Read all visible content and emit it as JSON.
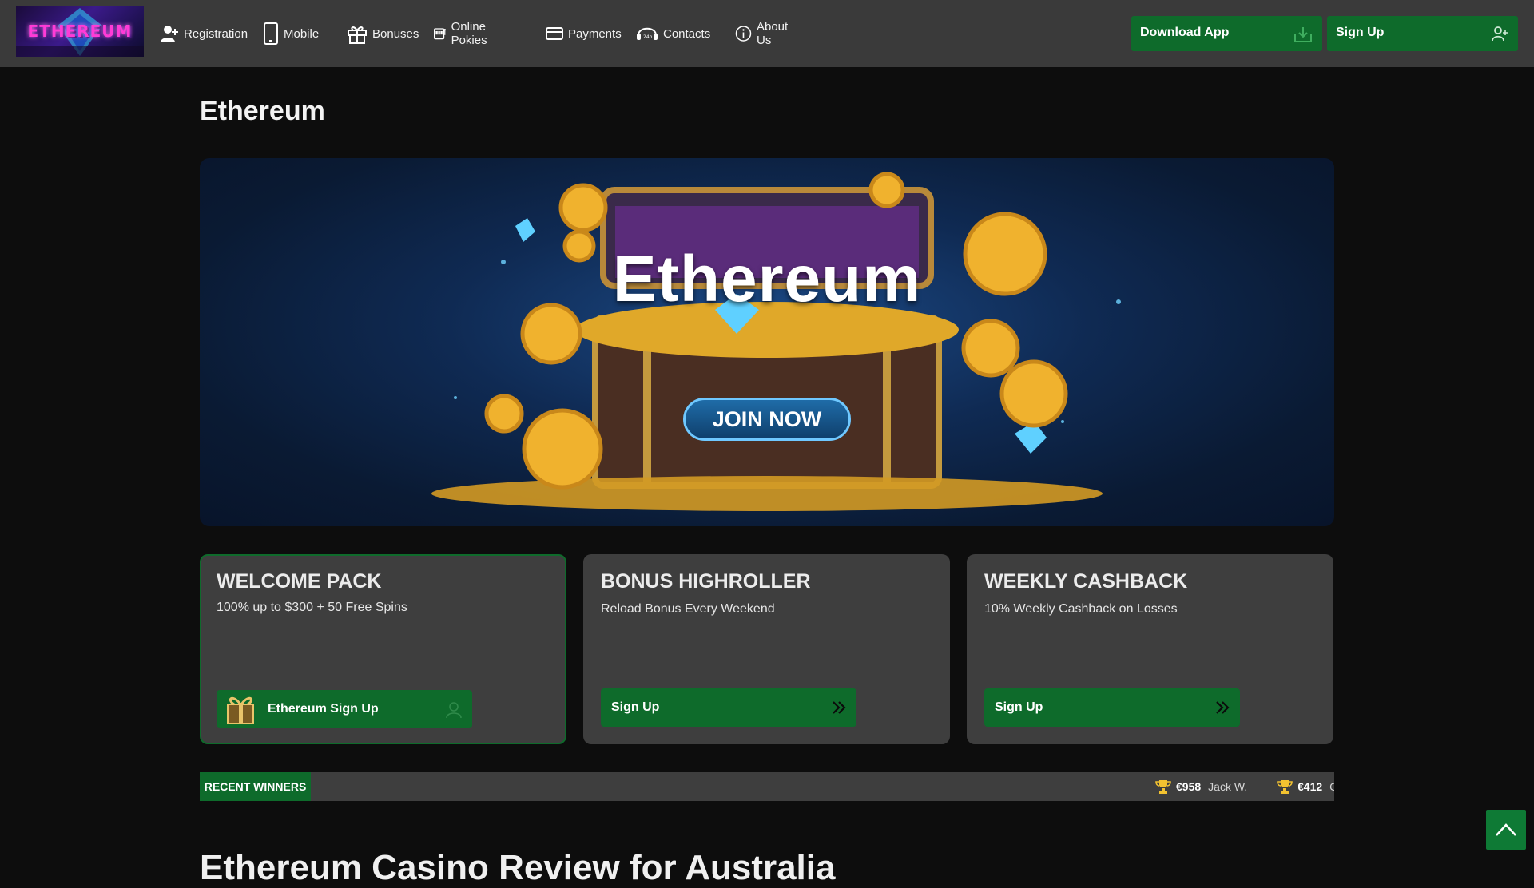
{
  "header": {
    "logo_text": "ETHEREUM",
    "nav": [
      {
        "label": "Registration",
        "icon": "user-plus-icon"
      },
      {
        "label": "Mobile",
        "icon": "phone-icon"
      },
      {
        "label": "Bonuses",
        "icon": "gift-icon"
      },
      {
        "label": "Online Pokies",
        "icon": "slot-machine-icon"
      },
      {
        "label": "Payments",
        "icon": "card-icon"
      },
      {
        "label": "Contacts",
        "icon": "headset-24-icon"
      },
      {
        "label": "About Us",
        "icon": "info-icon"
      }
    ],
    "download_label": "Download App",
    "signup_label": "Sign Up"
  },
  "main": {
    "title": "Ethereum",
    "hero": {
      "brand": "Ethereum",
      "cta": "JOIN NOW"
    }
  },
  "cards": [
    {
      "title": "WELCOME PACK",
      "subtitle": "100% up to $300 + 50 Free Spins",
      "button": "Ethereum Sign Up"
    },
    {
      "title": "BONUS HIGHROLLER",
      "subtitle": "Reload Bonus Every Weekend",
      "button": "Sign Up"
    },
    {
      "title": "WEEKLY CASHBACK",
      "subtitle": "10% Weekly Cashback on Losses",
      "button": "Sign Up"
    }
  ],
  "winners": {
    "label": "RECENT WINNERS",
    "items": [
      {
        "amount": "€958",
        "name": "Jack W."
      },
      {
        "amount": "€412",
        "name": "C"
      }
    ]
  },
  "section_heading": "Ethereum Casino Review for Australia",
  "colors": {
    "accent_green": "#0e6b2b",
    "header_bg": "#3a3a3a",
    "page_bg": "#0d0d0d",
    "card_bg": "#3e3e3e"
  }
}
